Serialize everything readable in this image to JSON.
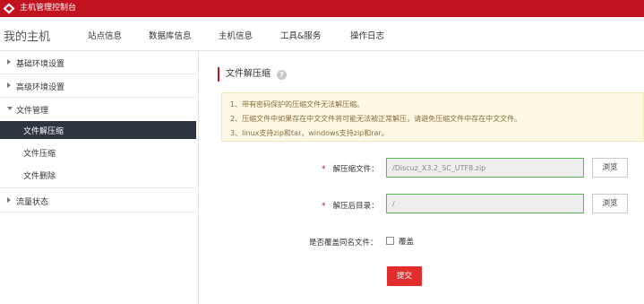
{
  "topbar": {
    "title": "主机管理控制台",
    "logo_icon": "diamond-logo-icon"
  },
  "nav": {
    "home": "我的主机",
    "items": [
      "站点信息",
      "数据库信息",
      "主机信息",
      "工具&服务",
      "操作日志"
    ]
  },
  "sidebar": {
    "groups": [
      {
        "label": "基础环境设置",
        "expanded": false
      },
      {
        "label": "高级环境设置",
        "expanded": false
      },
      {
        "label": "文件管理",
        "expanded": true
      },
      {
        "label": "流量状态",
        "expanded": false
      }
    ],
    "file_items": [
      {
        "label": "文件解压缩",
        "active": true
      },
      {
        "label": "文件压缩",
        "active": false
      },
      {
        "label": "文件删除",
        "active": false
      }
    ]
  },
  "section": {
    "title": "文件解压缩",
    "help_icon": "?"
  },
  "notice": [
    "1、带有密码保护的压缩文件无法解压缩。",
    "2、压缩文件中如果存在中文文件将可能无法被正常解压，请避免压缩文件中存在中文文件。",
    "3、linux支持zip和tar，windows支持zip和rar。"
  ],
  "form": {
    "required_mark": "*",
    "archive_label": "解压缩文件：",
    "archive_value": "/Discuz_X3.2_SC_UTF8.zip",
    "target_label": "解压后目录：",
    "target_value": "/",
    "browse_label": "浏览",
    "overwrite_question": "是否覆盖同名文件：",
    "overwrite_label": "覆盖",
    "submit_label": "提交"
  },
  "colors": {
    "brand": "#c1121f",
    "active_bg": "#2e3440",
    "submit": "#e32c2c",
    "input_border": "#5cb85c",
    "notice_bg": "#fdf8e4"
  }
}
